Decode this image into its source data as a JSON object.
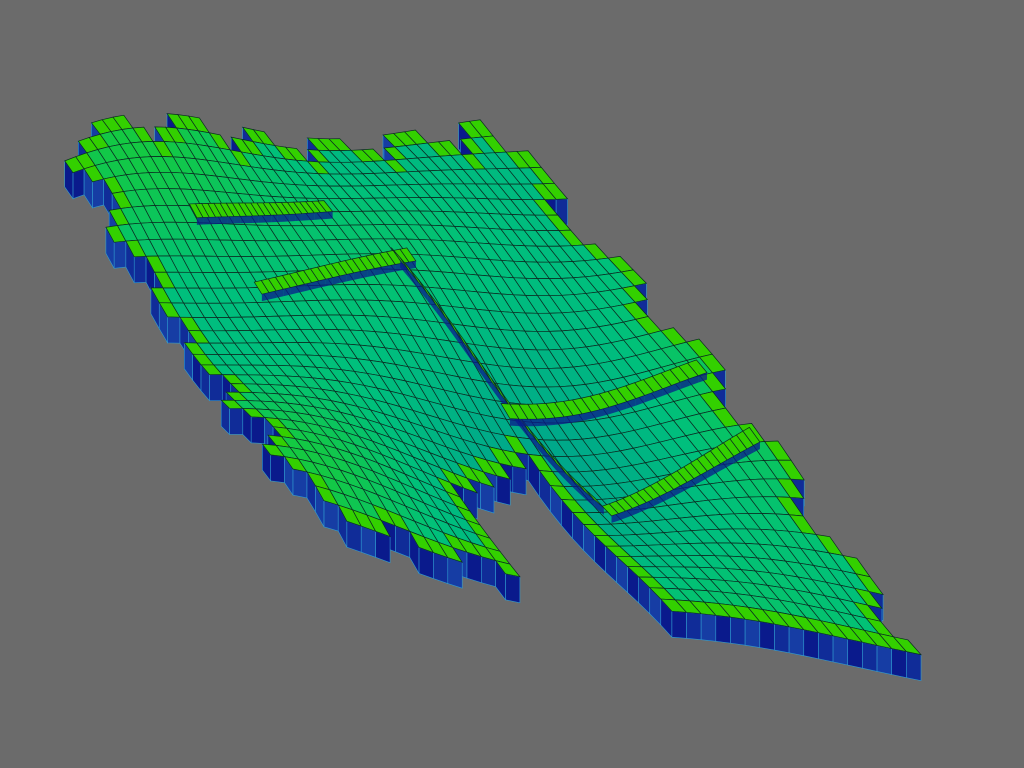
{
  "viewer": {
    "background_color": "#6b6b6b"
  },
  "grid_model": {
    "surface_colors": {
      "top_low": "#00a88a",
      "top_mid": "#00c07c",
      "top_high": "#15c940",
      "ridge": "#33d000",
      "side_dark": "#0a1a8c",
      "side_mid": "#1c4fb0",
      "side_light": "#2f9bd0",
      "cell_line": "#0b2b22"
    }
  }
}
